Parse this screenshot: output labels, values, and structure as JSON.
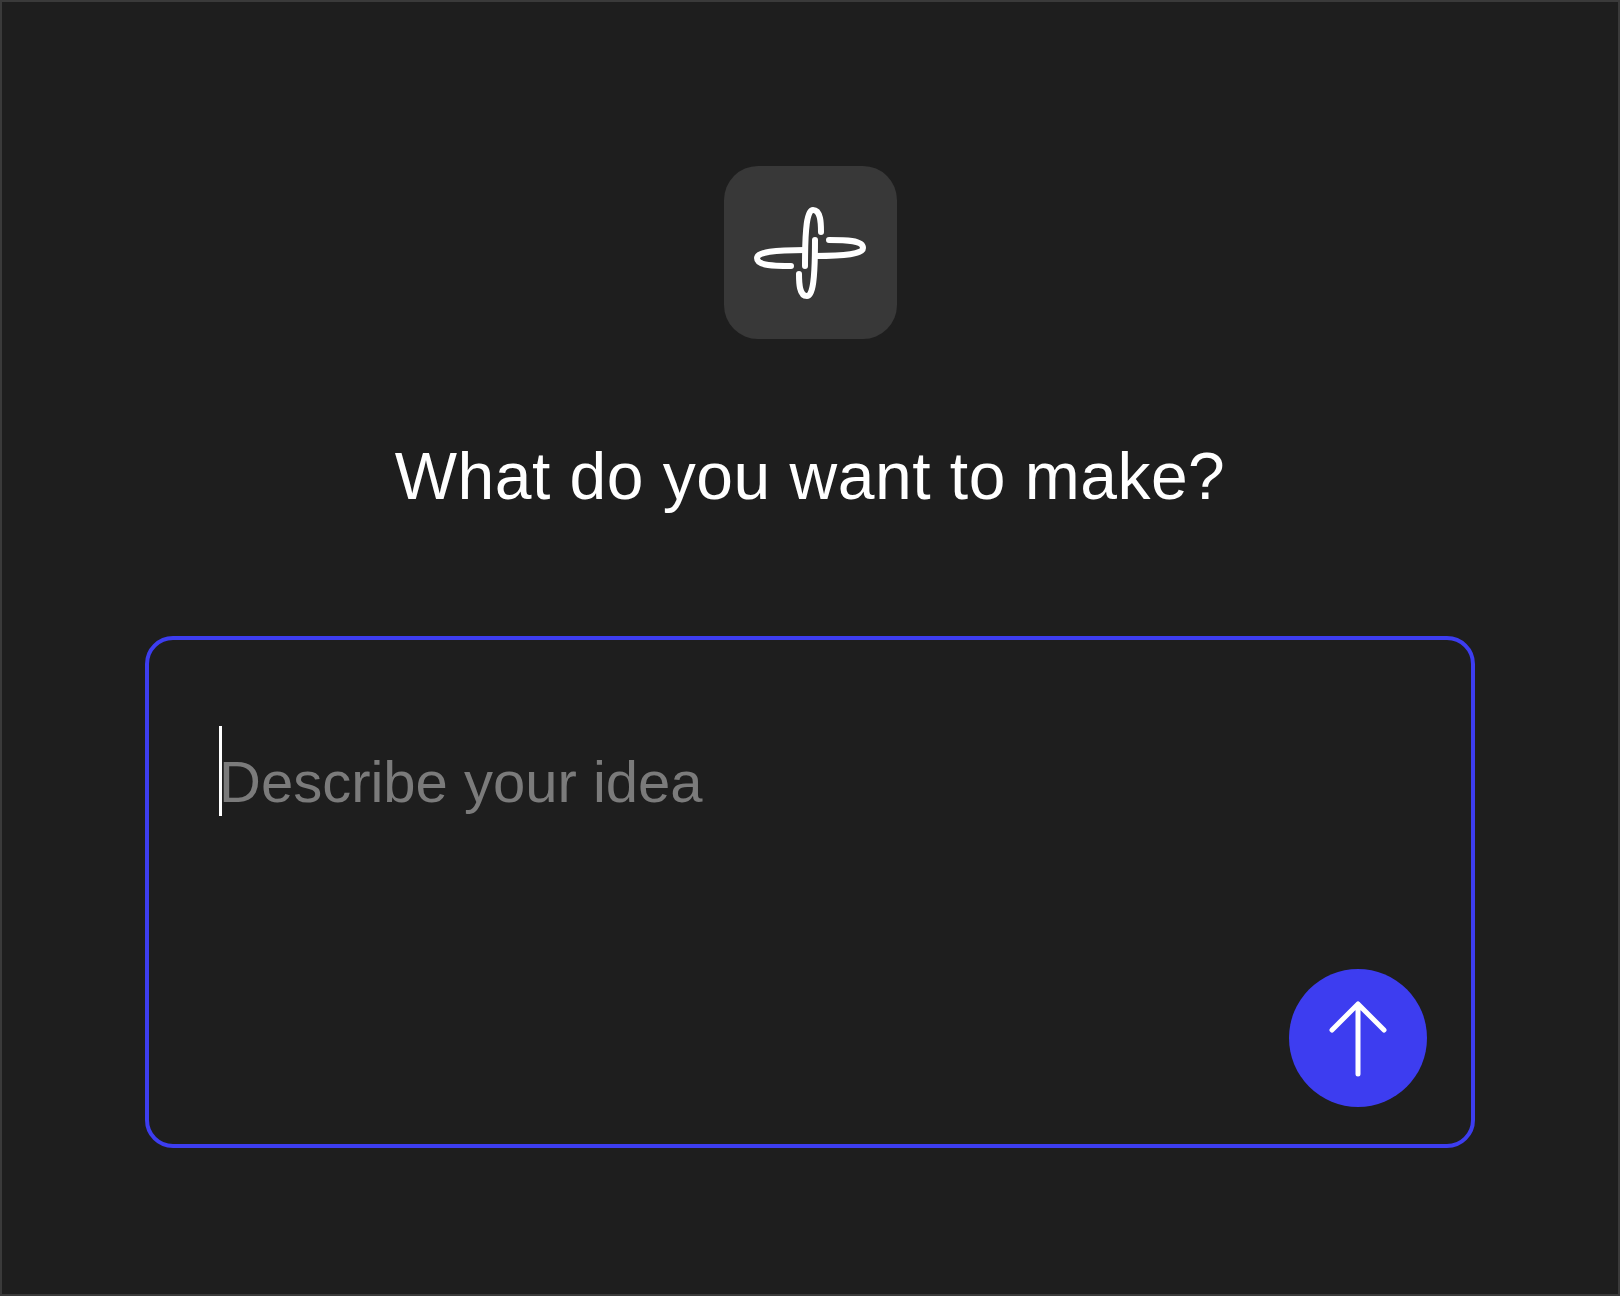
{
  "heading": "What do you want to make?",
  "prompt": {
    "placeholder": "Describe your idea",
    "focused": true
  }
}
